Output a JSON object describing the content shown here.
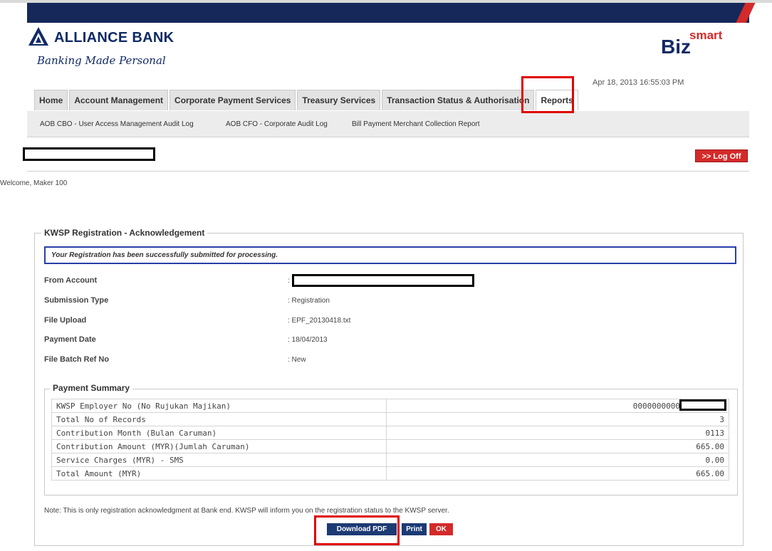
{
  "brand": {
    "bank_name": "ALLIANCE BANK",
    "tagline": "Banking Made Personal",
    "product_big": "Biz",
    "product_small": "smart"
  },
  "datetime": "Apr 18, 2013 16:55:03 PM",
  "nav": {
    "tabs": [
      {
        "label": "Home"
      },
      {
        "label": "Account Management"
      },
      {
        "label": "Corporate Payment Services"
      },
      {
        "label": "Treasury Services"
      },
      {
        "label": "Transaction Status & Authorisation"
      },
      {
        "label": "Reports"
      }
    ],
    "active_tab": "Reports",
    "submenu": [
      {
        "label": "AOB CBO - User Access Management Audit Log"
      },
      {
        "label": "AOB CFO - Corporate Audit Log"
      },
      {
        "label": "Bill Payment Merchant Collection Report"
      }
    ]
  },
  "header": {
    "logoff_label": ">> Log Off",
    "welcome": "Welcome, Maker 100"
  },
  "ack": {
    "title": "KWSP Registration - Acknowledgement",
    "success_message": "Your Registration has been successfully submitted for processing.",
    "fields": [
      {
        "label": "From Account",
        "value": ":"
      },
      {
        "label": "Submission Type",
        "value": ": Registration"
      },
      {
        "label": "File Upload",
        "value": ": EPF_20130418.txt"
      },
      {
        "label": "Payment Date",
        "value": ": 18/04/2013"
      },
      {
        "label": "File Batch Ref No",
        "value": ": New"
      }
    ]
  },
  "summary": {
    "title": "Payment Summary",
    "rows": [
      {
        "label": "KWSP Employer No (No Rujukan Majikan)",
        "value": "0000000000"
      },
      {
        "label": "Total No of Records",
        "value": "3"
      },
      {
        "label": "Contribution Month (Bulan Caruman)",
        "value": "0113"
      },
      {
        "label": "Contribution Amount (MYR)(Jumlah Caruman)",
        "value": "665.00"
      },
      {
        "label": "Service Charges (MYR) - SMS",
        "value": "0.00"
      },
      {
        "label": "Total Amount (MYR)",
        "value": "665.00"
      }
    ]
  },
  "note": "Note: This is only registration acknowledgment at Bank end. KWSP will inform you on the registration status to the KWSP server.",
  "buttons": {
    "download": "Download PDF",
    "print": "Print",
    "ok": "OK"
  },
  "colors": {
    "navy": "#16285a",
    "red": "#d42a2a",
    "highlight": "#e00000"
  }
}
